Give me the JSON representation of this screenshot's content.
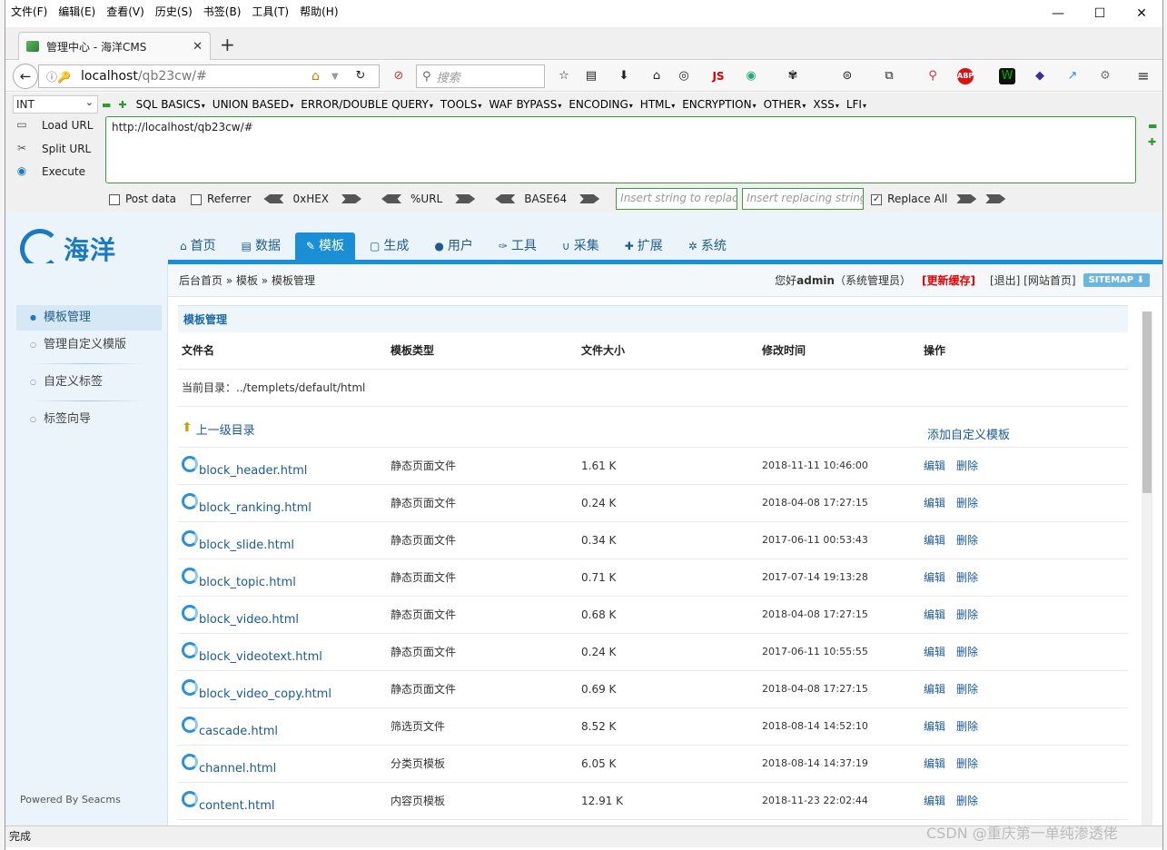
{
  "menubar": [
    "文件(F)",
    "编辑(E)",
    "查看(V)",
    "历史(S)",
    "书签(B)",
    "工具(T)",
    "帮助(H)"
  ],
  "tab": {
    "title": "管理中心 - 海洋CMS"
  },
  "url": {
    "host": "localhost",
    "path": "/qb23cw/#"
  },
  "search": {
    "placeholder": "搜索"
  },
  "hackbar": {
    "select": "INT",
    "menus": [
      "SQL BASICS",
      "UNION BASED",
      "ERROR/DOUBLE QUERY",
      "TOOLS",
      "WAF BYPASS",
      "ENCODING",
      "HTML",
      "ENCRYPTION",
      "OTHER",
      "XSS",
      "LFI"
    ],
    "load": "Load URL",
    "split": "Split URL",
    "execute": "Execute",
    "url_value": "http://localhost/qb23cw/#",
    "post": "Post data",
    "referrer": "Referrer",
    "hex": "0xHEX",
    "url_enc": "%URL",
    "base64": "BASE64",
    "replace_ph": "Insert string to replace",
    "replacing_ph": "Insert replacing string",
    "replace_all": "Replace All"
  },
  "nav": [
    {
      "icon": "⌂",
      "label": "首页"
    },
    {
      "icon": "▤",
      "label": "数据"
    },
    {
      "icon": "✎",
      "label": "模板"
    },
    {
      "icon": "▢",
      "label": "生成"
    },
    {
      "icon": "●",
      "label": "用户"
    },
    {
      "icon": "✑",
      "label": "工具"
    },
    {
      "icon": "∪",
      "label": "采集"
    },
    {
      "icon": "✚",
      "label": "扩展"
    },
    {
      "icon": "✲",
      "label": "系统"
    }
  ],
  "logo": "海洋",
  "crumb": {
    "text": "后台首页 » 模板 » 模板管理",
    "greeting": "您好",
    "user": "admin",
    "role": "（系统管理员）",
    "update": "[更新缓存]",
    "links": "[退出] [网站首页]",
    "sitemap": "SITEMAP ⬇"
  },
  "sidebar": [
    "模板管理",
    "管理自定义模版",
    "自定义标签",
    "标签向导"
  ],
  "powered": "Powered By Seacms",
  "box": {
    "title": "模板管理",
    "cols": [
      "文件名",
      "模板类型",
      "文件大小",
      "修改时间",
      "操作"
    ],
    "current_dir": "当前目录：../templets/default/html",
    "up": "上一级目录",
    "add": "添加自定义模板",
    "edit": "编辑",
    "del": "删除"
  },
  "files": [
    {
      "name": "block_header.html",
      "type": "静态页面文件",
      "size": "1.61 K",
      "time": "2018-11-11 10:46:00"
    },
    {
      "name": "block_ranking.html",
      "type": "静态页面文件",
      "size": "0.24 K",
      "time": "2018-04-08 17:27:15"
    },
    {
      "name": "block_slide.html",
      "type": "静态页面文件",
      "size": "0.34 K",
      "time": "2017-06-11 00:53:43"
    },
    {
      "name": "block_topic.html",
      "type": "静态页面文件",
      "size": "0.71 K",
      "time": "2017-07-14 19:13:28"
    },
    {
      "name": "block_video.html",
      "type": "静态页面文件",
      "size": "0.68 K",
      "time": "2018-04-08 17:27:15"
    },
    {
      "name": "block_videotext.html",
      "type": "静态页面文件",
      "size": "0.24 K",
      "time": "2017-06-11 10:55:55"
    },
    {
      "name": "block_video_copy.html",
      "type": "静态页面文件",
      "size": "0.69 K",
      "time": "2018-04-08 17:27:15"
    },
    {
      "name": "cascade.html",
      "type": "筛选页文件",
      "size": "8.52 K",
      "time": "2018-08-14 14:52:10"
    },
    {
      "name": "channel.html",
      "type": "分类页模板",
      "size": "6.05 K",
      "time": "2018-08-14 14:37:19"
    },
    {
      "name": "content.html",
      "type": "内容页模板",
      "size": "12.91 K",
      "time": "2018-11-23 22:02:44"
    }
  ],
  "status": "完成",
  "watermark": "CSDN @重庆第一单纯渗透佬"
}
